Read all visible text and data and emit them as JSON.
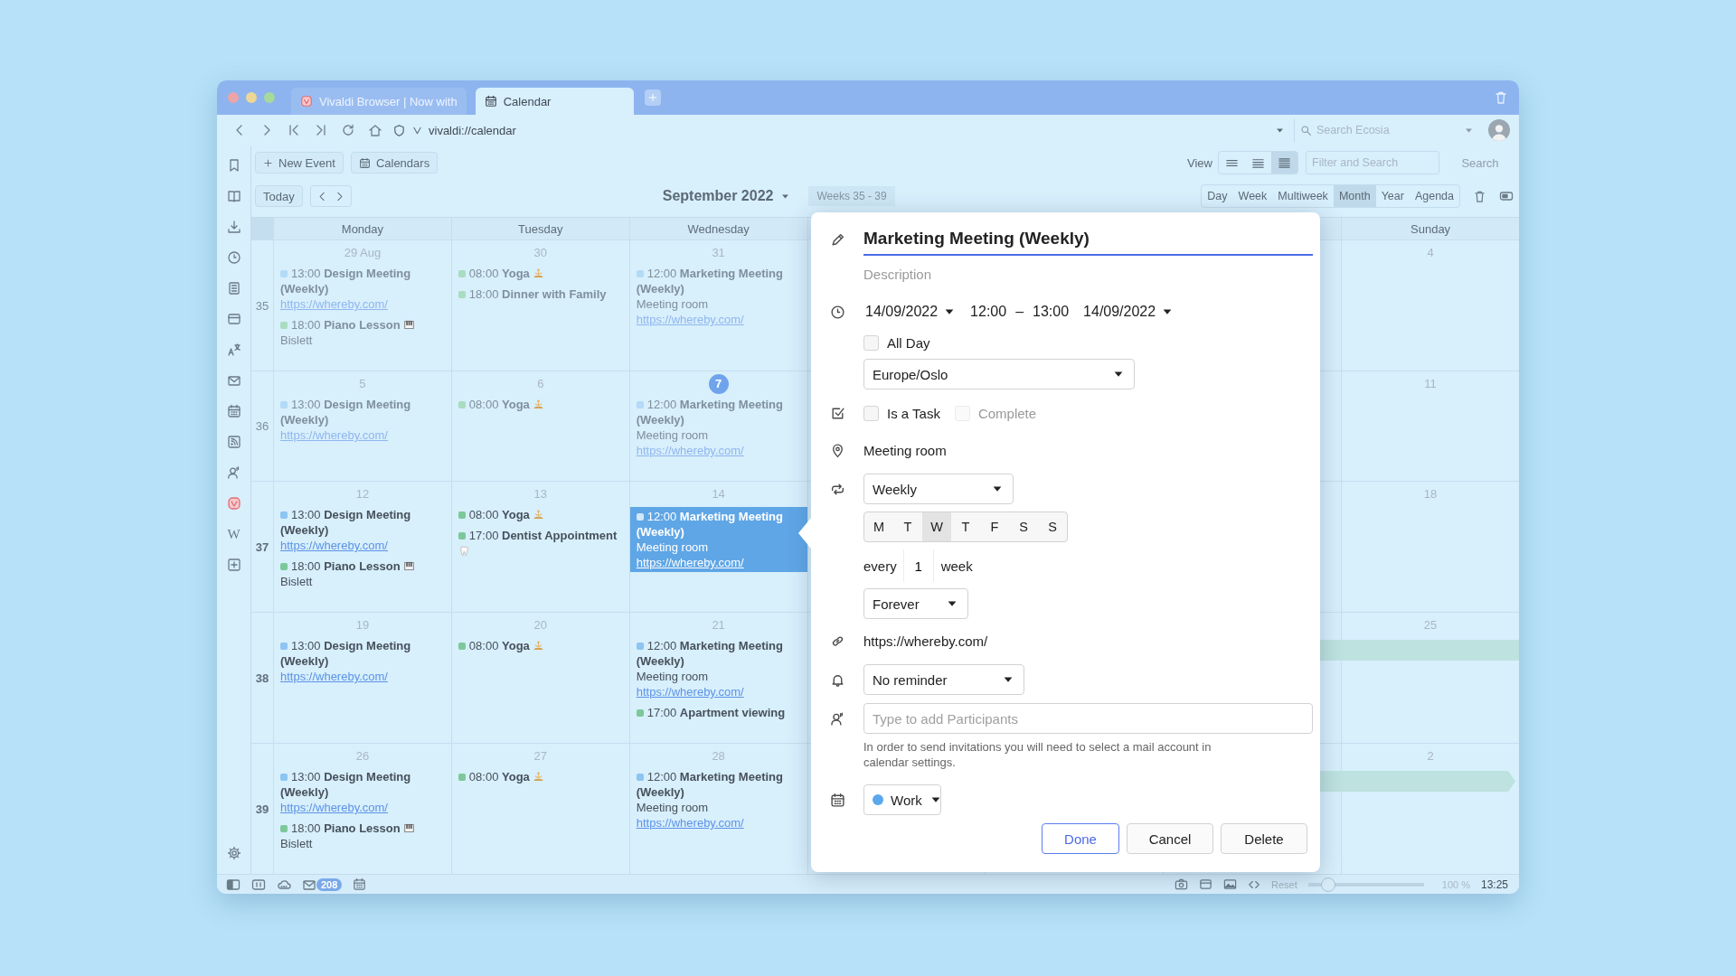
{
  "tabs": [
    {
      "title": "Vivaldi Browser | Now with",
      "kind": "vivaldi",
      "selected": false
    },
    {
      "title": "Calendar",
      "kind": "calendar",
      "selected": true
    }
  ],
  "address_bar": {
    "url": "vivaldi://calendar",
    "search": {
      "placeholder": "Search Ecosia"
    }
  },
  "sidebar": {
    "wiki_label": "W"
  },
  "toolbar": {
    "new_event": "New Event",
    "calendars": "Calendars",
    "view_label": "View",
    "view_density": [
      {
        "selected": false
      },
      {
        "selected": false
      },
      {
        "selected": true
      }
    ],
    "filter": {
      "placeholder": "Filter and Search"
    },
    "search_button": "Search",
    "today": "Today",
    "month_title": "September 2022",
    "weeks_label": "Weeks 35 - 39",
    "ranges": [
      {
        "label": "Day",
        "selected": false
      },
      {
        "label": "Week",
        "selected": false
      },
      {
        "label": "Multiweek",
        "selected": false
      },
      {
        "label": "Month",
        "selected": true
      },
      {
        "label": "Year",
        "selected": false
      },
      {
        "label": "Agenda",
        "selected": false
      }
    ]
  },
  "columns_left": [
    "Monday",
    "Tuesday",
    "Wednesday"
  ],
  "columns_right": [
    "Sunday"
  ],
  "weeks": [
    {
      "number": "35",
      "dimmed": true,
      "days_left": [
        {
          "date": "29 Aug",
          "today": false,
          "events": [
            {
              "kind": "plain",
              "time": "13:00",
              "title": "Design Meeting (Weekly)",
              "color": "#b3daf7",
              "selected": false,
              "link": "https://whereby.com/"
            },
            {
              "kind": "lesson",
              "time": "18:00",
              "title": "Piano Lesson",
              "color": "#a9dcc0",
              "selected": false,
              "location": "Bislett"
            }
          ]
        },
        {
          "date": "30",
          "today": false,
          "events": [
            {
              "kind": "yoga",
              "time": "08:00",
              "title": "Yoga",
              "color": "#a9dcc0",
              "selected": false
            },
            {
              "kind": "plain",
              "time": "18:00",
              "title": "Dinner with Family",
              "color": "#a9dcc0",
              "selected": false
            }
          ]
        },
        {
          "date": "31",
          "today": false,
          "events": [
            {
              "kind": "plain",
              "time": "12:00",
              "title": "Marketing Meeting (Weekly)",
              "color": "#b3daf7",
              "selected": false,
              "location": "Meeting room",
              "link": "https://whereby.com/"
            }
          ]
        }
      ],
      "days_right": [
        {
          "date": "4",
          "today": false
        }
      ]
    },
    {
      "number": "36",
      "dimmed": true,
      "days_left": [
        {
          "date": "5",
          "today": false,
          "events": [
            {
              "kind": "plain",
              "time": "13:00",
              "title": "Design Meeting (Weekly)",
              "color": "#b3daf7",
              "selected": false,
              "link": "https://whereby.com/"
            }
          ]
        },
        {
          "date": "6",
          "today": false,
          "events": [
            {
              "kind": "yoga",
              "time": "08:00",
              "title": "Yoga",
              "color": "#a9dcc0",
              "selected": false
            }
          ]
        },
        {
          "date": "7",
          "today": true,
          "events": [
            {
              "kind": "plain",
              "time": "12:00",
              "title": "Marketing Meeting (Weekly)",
              "color": "#b3daf7",
              "selected": false,
              "location": "Meeting room",
              "link": "https://whereby.com/"
            }
          ]
        }
      ],
      "days_right": [
        {
          "date": "11",
          "today": false
        }
      ]
    },
    {
      "number": "37",
      "dimmed": false,
      "days_left": [
        {
          "date": "12",
          "today": false,
          "events": [
            {
              "kind": "plain",
              "time": "13:00",
              "title": "Design Meeting (Weekly)",
              "color": "#8cc4f2",
              "selected": false,
              "link": "https://whereby.com/"
            },
            {
              "kind": "lesson",
              "time": "18:00",
              "title": "Piano Lesson",
              "color": "#7cc89a",
              "selected": false,
              "location": "Bislett"
            }
          ]
        },
        {
          "date": "13",
          "today": false,
          "events": [
            {
              "kind": "yoga",
              "time": "08:00",
              "title": "Yoga",
              "color": "#7cc89a",
              "selected": false
            },
            {
              "kind": "dentist",
              "time": "17:00",
              "title": "Dentist Appointment",
              "color": "#7cc89a",
              "selected": false
            }
          ]
        },
        {
          "date": "14",
          "today": false,
          "events": [
            {
              "kind": "plain",
              "time": "12:00",
              "title": "Marketing Meeting (Weekly)",
              "color": "#d3e8f8",
              "selected": true,
              "location": "Meeting room",
              "link": "https://whereby.com/"
            }
          ]
        }
      ],
      "days_right": [
        {
          "date": "18",
          "today": false
        }
      ]
    },
    {
      "number": "38",
      "dimmed": false,
      "bar": {
        "continues": false
      },
      "days_left": [
        {
          "date": "19",
          "today": false,
          "events": [
            {
              "kind": "plain",
              "time": "13:00",
              "title": "Design Meeting (Weekly)",
              "color": "#8cc4f2",
              "selected": false,
              "link": "https://whereby.com/"
            }
          ]
        },
        {
          "date": "20",
          "today": false,
          "events": [
            {
              "kind": "yoga",
              "time": "08:00",
              "title": "Yoga",
              "color": "#7cc89a",
              "selected": false
            }
          ]
        },
        {
          "date": "21",
          "today": false,
          "events": [
            {
              "kind": "plain",
              "time": "12:00",
              "title": "Marketing Meeting (Weekly)",
              "color": "#8cc4f2",
              "selected": false,
              "location": "Meeting room",
              "link": "https://whereby.com/"
            },
            {
              "kind": "plain",
              "time": "17:00",
              "title": "Apartment viewing",
              "color": "#7cc89a",
              "selected": false
            }
          ]
        }
      ],
      "days_right": [
        {
          "date": "25",
          "today": false
        }
      ]
    },
    {
      "number": "39",
      "dimmed": false,
      "bar": {
        "continues": true
      },
      "days_left": [
        {
          "date": "26",
          "today": false,
          "events": [
            {
              "kind": "plain",
              "time": "13:00",
              "title": "Design Meeting (Weekly)",
              "color": "#8cc4f2",
              "selected": false,
              "link": "https://whereby.com/"
            },
            {
              "kind": "lesson",
              "time": "18:00",
              "title": "Piano Lesson",
              "color": "#7cc89a",
              "selected": false,
              "location": "Bislett"
            }
          ]
        },
        {
          "date": "27",
          "today": false,
          "events": [
            {
              "kind": "yoga",
              "time": "08:00",
              "title": "Yoga",
              "color": "#7cc89a",
              "selected": false
            }
          ]
        },
        {
          "date": "28",
          "today": false,
          "events": [
            {
              "kind": "plain",
              "time": "12:00",
              "title": "Marketing Meeting (Weekly)",
              "color": "#8cc4f2",
              "selected": false,
              "location": "Meeting room",
              "link": "https://whereby.com/"
            }
          ]
        }
      ],
      "days_right": [
        {
          "date": "2",
          "today": false
        }
      ]
    }
  ],
  "dialog": {
    "title": "Marketing Meeting (Weekly)",
    "description": {
      "placeholder": "Description"
    },
    "start_date": "14/09/2022",
    "start_time": "12:00",
    "separator": "–",
    "end_time": "13:00",
    "end_date": "14/09/2022",
    "all_day": {
      "label": "All Day",
      "checked": false
    },
    "timezone": "Europe/Oslo",
    "task": {
      "label": "Is a Task",
      "checked": false
    },
    "complete": {
      "label": "Complete",
      "checked": false,
      "disabled": true
    },
    "location": "Meeting room",
    "recurrence": "Weekly",
    "weekdays": [
      {
        "label": "M",
        "selected": false
      },
      {
        "label": "T",
        "selected": false
      },
      {
        "label": "W",
        "selected": true
      },
      {
        "label": "T",
        "selected": false
      },
      {
        "label": "F",
        "selected": false
      },
      {
        "label": "S",
        "selected": false
      },
      {
        "label": "S",
        "selected": false
      }
    ],
    "every": {
      "prefix": "every",
      "value": "1",
      "unit": "week"
    },
    "ends": "Forever",
    "link": "https://whereby.com/",
    "reminder": "No reminder",
    "participants": {
      "placeholder": "Type to add Participants"
    },
    "help_text": "In order to send invitations you will need to select a mail account in calendar settings.",
    "calendar": {
      "label": "Work",
      "color": "#5aa8ec"
    },
    "buttons": [
      {
        "label": "Done",
        "kind": "primary"
      },
      {
        "label": "Cancel",
        "kind": "normal"
      },
      {
        "label": "Delete",
        "kind": "normal"
      }
    ]
  },
  "status_bar": {
    "mail_count": "208",
    "zoom": {
      "reset": "Reset",
      "level": 0.17,
      "reading": "100 %"
    },
    "clock": "13:25"
  }
}
